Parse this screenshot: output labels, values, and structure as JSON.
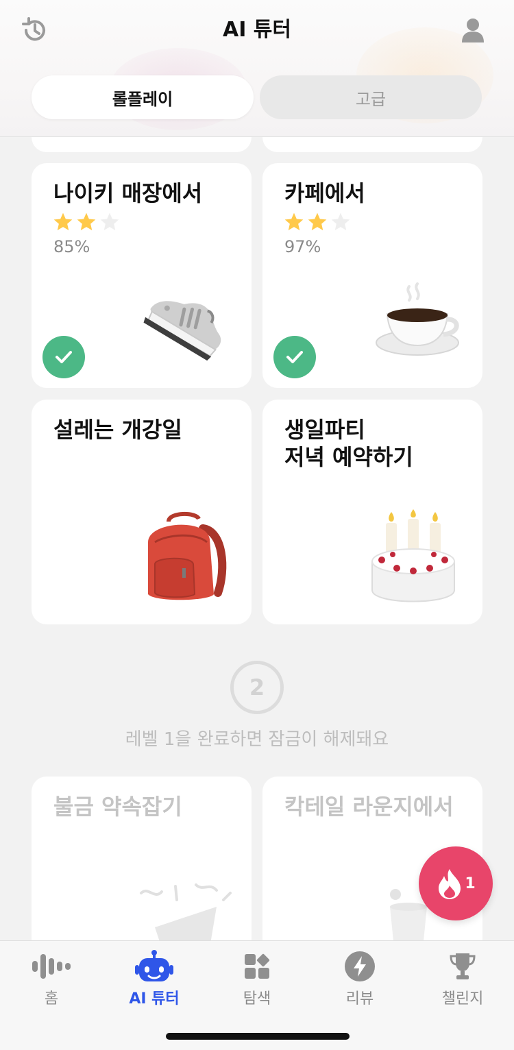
{
  "header": {
    "title": "AI 튜터",
    "tabs": [
      {
        "label": "롤플레이",
        "active": true
      },
      {
        "label": "고급",
        "active": false
      }
    ]
  },
  "cards": [
    {
      "title": "나이키 매장에서",
      "stars_filled": 2,
      "stars_total": 3,
      "percent": "85%",
      "completed": true,
      "art": "sneaker"
    },
    {
      "title": "카페에서",
      "stars_filled": 2,
      "stars_total": 3,
      "percent": "97%",
      "completed": true,
      "art": "coffee-cup"
    },
    {
      "title": "설레는 개강일",
      "completed": false,
      "art": "backpack"
    },
    {
      "title_lines": [
        "생일파티",
        "저녁 예약하기"
      ],
      "completed": false,
      "art": "birthday-cake"
    }
  ],
  "level": {
    "number": "2",
    "message": "레벨 1을 완료하면 잠금이 해제돼요"
  },
  "locked_cards": [
    {
      "title": "불금 약속잡기",
      "art": "party-popper"
    },
    {
      "title": "칵테일 라운지에서",
      "art": "cocktail"
    }
  ],
  "streak": {
    "count": "1"
  },
  "nav": {
    "items": [
      {
        "label": "홈",
        "icon": "waveform-icon"
      },
      {
        "label": "AI 튜터",
        "icon": "robot-icon",
        "active": true
      },
      {
        "label": "탐색",
        "icon": "grid-icon"
      },
      {
        "label": "리뷰",
        "icon": "lightning-icon"
      },
      {
        "label": "챌린지",
        "icon": "trophy-icon"
      }
    ]
  },
  "colors": {
    "accent_blue": "#2f56e8",
    "check_green": "#4cb886",
    "fab_pink": "#e8456a",
    "star_yellow": "#ffc94a"
  }
}
